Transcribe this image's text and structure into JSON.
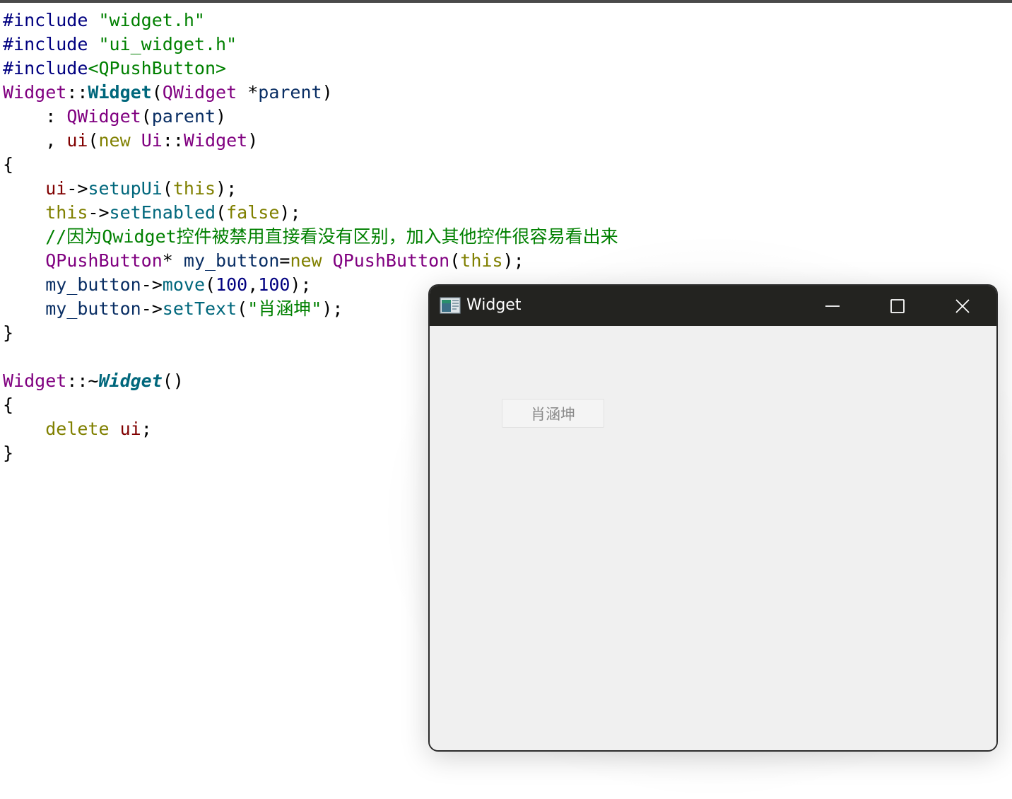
{
  "code": {
    "lines": [
      [
        {
          "t": "#include ",
          "c": "pre"
        },
        {
          "t": "\"widget.h\"",
          "c": "str"
        }
      ],
      [
        {
          "t": "#include ",
          "c": "pre"
        },
        {
          "t": "\"ui_widget.h\"",
          "c": "str"
        }
      ],
      [
        {
          "t": "#include",
          "c": "pre"
        },
        {
          "t": "<QPushButton>",
          "c": "str"
        }
      ],
      [
        {
          "t": "Widget",
          "c": "cls"
        },
        {
          "t": "::",
          "c": "op"
        },
        {
          "t": "Widget",
          "c": "fn-def"
        },
        {
          "t": "(",
          "c": "op"
        },
        {
          "t": "QWidget",
          "c": "cls"
        },
        {
          "t": " *",
          "c": "op"
        },
        {
          "t": "parent",
          "c": "var"
        },
        {
          "t": ")",
          "c": "op"
        }
      ],
      [
        {
          "t": "    : ",
          "c": "op"
        },
        {
          "t": "QWidget",
          "c": "cls"
        },
        {
          "t": "(",
          "c": "op"
        },
        {
          "t": "parent",
          "c": "var"
        },
        {
          "t": ")",
          "c": "op"
        }
      ],
      [
        {
          "t": "    , ",
          "c": "op"
        },
        {
          "t": "ui",
          "c": "mem"
        },
        {
          "t": "(",
          "c": "op"
        },
        {
          "t": "new",
          "c": "kw"
        },
        {
          "t": " ",
          "c": "op"
        },
        {
          "t": "Ui",
          "c": "cls"
        },
        {
          "t": "::",
          "c": "op"
        },
        {
          "t": "Widget",
          "c": "cls"
        },
        {
          "t": ")",
          "c": "op"
        }
      ],
      [
        {
          "t": "{",
          "c": "op"
        }
      ],
      [
        {
          "t": "    ",
          "c": "op"
        },
        {
          "t": "ui",
          "c": "mem"
        },
        {
          "t": "->",
          "c": "op"
        },
        {
          "t": "setupUi",
          "c": "fn"
        },
        {
          "t": "(",
          "c": "op"
        },
        {
          "t": "this",
          "c": "kw"
        },
        {
          "t": ");",
          "c": "op"
        }
      ],
      [
        {
          "t": "    ",
          "c": "op"
        },
        {
          "t": "this",
          "c": "kw"
        },
        {
          "t": "->",
          "c": "op"
        },
        {
          "t": "setEnabled",
          "c": "fn"
        },
        {
          "t": "(",
          "c": "op"
        },
        {
          "t": "false",
          "c": "kw"
        },
        {
          "t": ");",
          "c": "op"
        }
      ],
      [
        {
          "t": "    //因为Qwidget控件被禁用直接看没有区别，加入其他控件很容易看出来",
          "c": "cmt"
        }
      ],
      [
        {
          "t": "    ",
          "c": "op"
        },
        {
          "t": "QPushButton",
          "c": "cls"
        },
        {
          "t": "* ",
          "c": "op"
        },
        {
          "t": "my_button",
          "c": "var"
        },
        {
          "t": "=",
          "c": "op"
        },
        {
          "t": "new",
          "c": "kw"
        },
        {
          "t": " ",
          "c": "op"
        },
        {
          "t": "QPushButton",
          "c": "cls"
        },
        {
          "t": "(",
          "c": "op"
        },
        {
          "t": "this",
          "c": "kw"
        },
        {
          "t": ");",
          "c": "op"
        }
      ],
      [
        {
          "t": "    ",
          "c": "op"
        },
        {
          "t": "my_button",
          "c": "var"
        },
        {
          "t": "->",
          "c": "op"
        },
        {
          "t": "move",
          "c": "fn"
        },
        {
          "t": "(",
          "c": "op"
        },
        {
          "t": "100",
          "c": "num"
        },
        {
          "t": ",",
          "c": "op"
        },
        {
          "t": "100",
          "c": "num"
        },
        {
          "t": ");",
          "c": "op"
        }
      ],
      [
        {
          "t": "    ",
          "c": "op"
        },
        {
          "t": "my_button",
          "c": "var"
        },
        {
          "t": "->",
          "c": "op"
        },
        {
          "t": "setText",
          "c": "fn"
        },
        {
          "t": "(",
          "c": "op"
        },
        {
          "t": "\"肖涵坤\"",
          "c": "str"
        },
        {
          "t": ");",
          "c": "op"
        }
      ],
      [
        {
          "t": "}",
          "c": "op"
        }
      ],
      [],
      [
        {
          "t": "Widget",
          "c": "cls"
        },
        {
          "t": "::~",
          "c": "op"
        },
        {
          "t": "Widget",
          "c": "fn-def-i"
        },
        {
          "t": "()",
          "c": "op"
        }
      ],
      [
        {
          "t": "{",
          "c": "op"
        }
      ],
      [
        {
          "t": "    ",
          "c": "op"
        },
        {
          "t": "delete",
          "c": "kw"
        },
        {
          "t": " ",
          "c": "op"
        },
        {
          "t": "ui",
          "c": "mem"
        },
        {
          "t": ";",
          "c": "op"
        }
      ],
      [
        {
          "t": "}",
          "c": "op"
        }
      ]
    ]
  },
  "window": {
    "title": "Widget",
    "app_icon": "qt-widget-app-icon",
    "minimize_icon": "minimize-icon",
    "maximize_icon": "maximize-icon",
    "close_icon": "close-icon",
    "button_label": "肖涵坤",
    "button_enabled": false
  },
  "colors": {
    "titlebar": "#232320",
    "client_bg": "#f0f0f0",
    "disabled_text": "#8a8a8a"
  }
}
